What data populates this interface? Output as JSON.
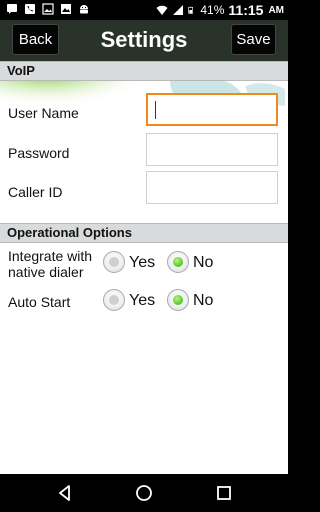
{
  "status_bar": {
    "battery_percent": "41%",
    "time": "11:15",
    "ampm": "AM",
    "left_icons": [
      "message-icon",
      "phone-icon",
      "gallery-icon",
      "photo-icon",
      "android-icon"
    ],
    "right_icons": [
      "wifi-icon",
      "signal-icon",
      "battery-icon"
    ]
  },
  "title_bar": {
    "back_label": "Back",
    "title": "Settings",
    "save_label": "Save"
  },
  "voip": {
    "header": "VoIP",
    "user_name_label": "User Name",
    "user_name_value": "",
    "password_label": "Password",
    "password_value": "",
    "caller_id_label": "Caller ID",
    "caller_id_value": ""
  },
  "operational": {
    "header": "Operational Options",
    "integrate_label_line1": "Integrate with",
    "integrate_label_line2": "native dialer",
    "integrate_selected": "No",
    "auto_start_label": "Auto Start",
    "auto_start_selected": "No",
    "yes_label": "Yes",
    "no_label": "No"
  },
  "colors": {
    "focus_border": "#f08a1a",
    "radio_checked": "#5fcf2b",
    "title_bar_bg": "#2a332a",
    "section_header_bg": "#d8dadc"
  },
  "nav_bar": {
    "buttons": [
      "back-triangle-icon",
      "home-circle-icon",
      "recents-square-icon"
    ]
  }
}
